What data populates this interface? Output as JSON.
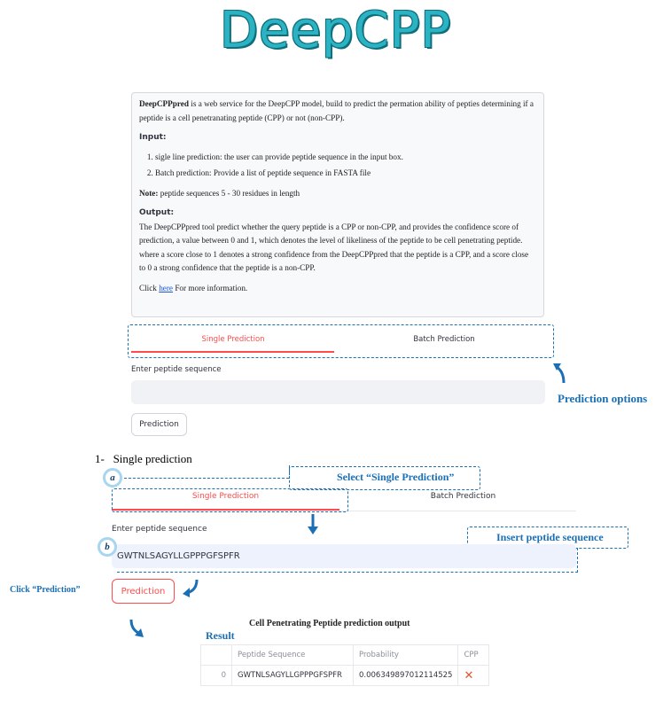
{
  "logo": {
    "text": "DeepCPP"
  },
  "description": {
    "intro_bold": "DeepCPPpred",
    "intro_rest": " is a web service for the DeepCPP model, build to predict the permation ability of pepties determining if a peptide is a cell penetranating peptide (CPP) or not (non-CPP).",
    "input_header": "Input:",
    "input_items": [
      "sigle line prediction: the user can provide peptide sequence in the input box.",
      "Batch prediction: Provide a list of peptide sequence in FASTA file"
    ],
    "note_bold": "Note:",
    "note_rest": " peptide sequences 5 - 30 residues in length",
    "output_header": "Output:",
    "output_text": "The DeepCPPpred tool predict whether the query peptide is a CPP or non-CPP, and provides the confidence score of prediction, a value between 0 and 1, which denotes the level of likeliness of the peptide to be cell penetrating peptide. where a score close to 1 denotes a strong confidence from the DeepCPPpred that the peptide is a CPP, and a score close to 0 a strong confidence that the peptide is a non-CPP.",
    "click_pre": "Click ",
    "click_link": "here",
    "click_post": " For more information."
  },
  "top_tabs": {
    "single": "Single Prediction",
    "batch": "Batch Prediction"
  },
  "top_input_label": "Enter peptide sequence",
  "top_input_value": "",
  "top_button": "Prediction",
  "annotation_prediction_options": "Prediction options",
  "section_title": "1-   Single prediction",
  "step_a": {
    "marker": "a",
    "text": "Select “Single Prediction”"
  },
  "step_b": {
    "marker": "b",
    "text": "Insert peptide sequence"
  },
  "bottom_tabs": {
    "single": "Single Prediction",
    "batch": "Batch Prediction"
  },
  "bottom_input_label": "Enter peptide sequence",
  "bottom_input_value": "GWTNLSAGYLLGPPPGFSPFR",
  "click_prediction_label": "Click “Prediction”",
  "bottom_button": "Prediction",
  "result_label": "Result",
  "output_title": "Cell Penetrating Peptide prediction output",
  "table": {
    "headers": [
      "",
      "Peptide Sequence",
      "Probability",
      "CPP"
    ],
    "rows": [
      {
        "index": "0",
        "sequence": "GWTNLSAGYLLGPPPGFSPFR",
        "probability": "0.006349897012114525",
        "cpp_icon": "cross-icon"
      }
    ]
  },
  "colors": {
    "accent": "#ff4b4b",
    "annotation": "#1a6fb5",
    "logo": "#2cb3c3"
  }
}
